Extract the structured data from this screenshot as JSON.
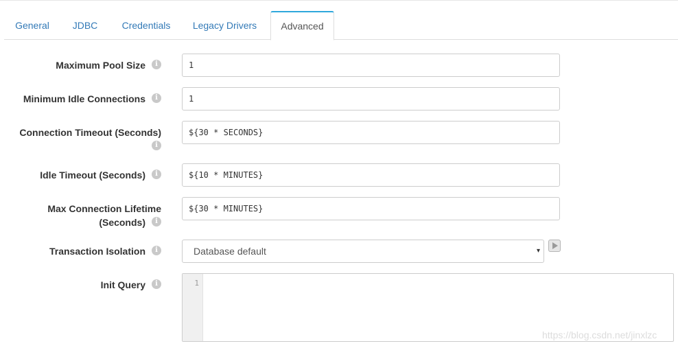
{
  "tabs": [
    {
      "label": "General",
      "active": false
    },
    {
      "label": "JDBC",
      "active": false
    },
    {
      "label": "Credentials",
      "active": false
    },
    {
      "label": "Legacy Drivers",
      "active": false
    },
    {
      "label": "Advanced",
      "active": true
    }
  ],
  "fields": {
    "max_pool_size": {
      "label": "Maximum Pool Size",
      "value": "1"
    },
    "min_idle": {
      "label": "Minimum Idle Connections",
      "value": "1"
    },
    "conn_timeout": {
      "label_line1": "Connection Timeout (Seconds)",
      "value": "${30 * SECONDS}"
    },
    "idle_timeout": {
      "label": "Idle Timeout (Seconds)",
      "value": "${10 * MINUTES}"
    },
    "max_lifetime": {
      "label_line1": "Max Connection Lifetime",
      "label_line2": "(Seconds)",
      "value": "${30 * MINUTES}"
    },
    "tx_isolation": {
      "label": "Transaction Isolation",
      "value": "Database default"
    },
    "init_query": {
      "label": "Init Query",
      "line_number": "1",
      "value": ""
    }
  },
  "icons": {
    "info": "i",
    "caret": "▾"
  },
  "colors": {
    "tab_link": "#337ab7",
    "active_tab_accent": "#2ea7dc"
  },
  "watermark": "https://blog.csdn.net/jinxlzc"
}
